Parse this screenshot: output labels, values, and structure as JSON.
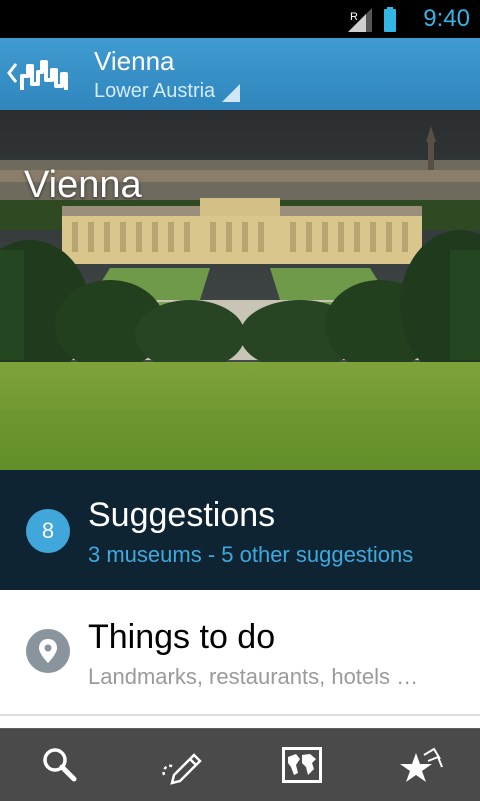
{
  "status_bar": {
    "time": "9:40",
    "roaming_indicator": "R",
    "icons": [
      "signal-icon",
      "battery-icon"
    ],
    "accent_color": "#33b5e5"
  },
  "action_bar": {
    "title": "Vienna",
    "subtitle": "Lower Austria",
    "icons": [
      "back-chevron-icon",
      "city-skyline-logo-icon",
      "dropdown-corner-icon"
    ],
    "color": "#3391c7"
  },
  "hero": {
    "title": "Vienna"
  },
  "suggestions": {
    "count": "8",
    "title": "Suggestions",
    "subtitle": "3 museums - 5 other suggestions",
    "background_color": "#0e2432",
    "accent_color": "#41a6d9"
  },
  "things_to_do": {
    "title": "Things to do",
    "subtitle": "Landmarks, restaurants, hotels …",
    "icon": "location-pin-icon"
  },
  "bottom_nav": {
    "items": [
      {
        "icon": "search-icon"
      },
      {
        "icon": "edit-pencil-icon"
      },
      {
        "icon": "world-map-icon"
      },
      {
        "icon": "stars-icon"
      }
    ]
  }
}
